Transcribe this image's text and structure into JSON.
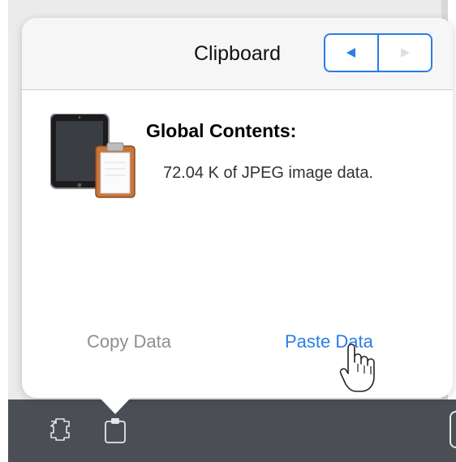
{
  "popover": {
    "title": "Clipboard",
    "prev_icon": "left-triangle-icon",
    "next_icon": "right-triangle-icon",
    "contents_label": "Global Contents:",
    "contents_description": "72.04 K of JPEG image data.",
    "copy_label": "Copy Data",
    "paste_label": "Paste Data"
  },
  "toolbar": {
    "fullscreen_icon": "fullscreen-icon",
    "clipboard_icon": "clipboard-icon"
  },
  "colors": {
    "accent": "#2b7de9",
    "disabled": "#8e8e93",
    "toolbar": "#4b4f55"
  }
}
